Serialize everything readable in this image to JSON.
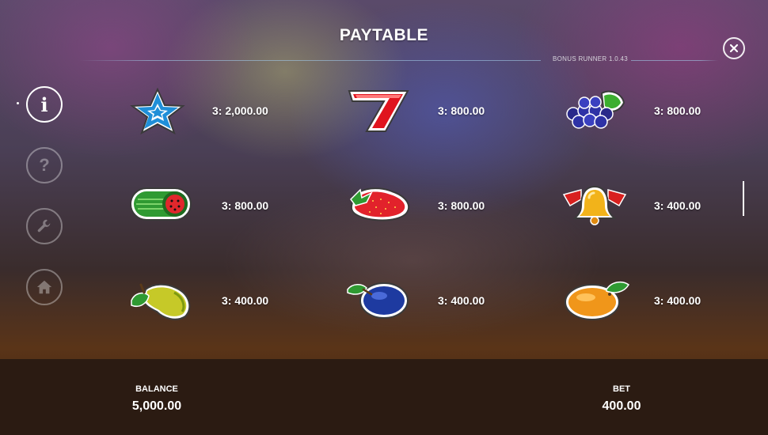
{
  "header": {
    "title": "PAYTABLE",
    "version": "BONUS RUNNER 1.0.43"
  },
  "close": {
    "icon": "close-icon",
    "label": "X"
  },
  "sidebar": {
    "items": [
      {
        "name": "info",
        "icon": "info-icon",
        "label": "i",
        "active": true
      },
      {
        "name": "help",
        "icon": "question-icon",
        "label": "?",
        "active": false
      },
      {
        "name": "settings",
        "icon": "wrench-icon",
        "active": false
      },
      {
        "name": "home",
        "icon": "home-icon",
        "active": false
      }
    ]
  },
  "symbols": [
    {
      "id": "star",
      "icon": "star-icon",
      "payout": "3: 2,000.00"
    },
    {
      "id": "seven",
      "icon": "seven-icon",
      "glyph": "7",
      "payout": "3: 800.00"
    },
    {
      "id": "grapes",
      "icon": "grapes-icon",
      "payout": "3: 800.00"
    },
    {
      "id": "watermelon",
      "icon": "watermelon-icon",
      "payout": "3: 800.00"
    },
    {
      "id": "strawberry",
      "icon": "strawberry-icon",
      "payout": "3: 800.00"
    },
    {
      "id": "bell",
      "icon": "bell-icon",
      "payout": "3: 400.00"
    },
    {
      "id": "pear",
      "icon": "pear-icon",
      "payout": "3: 400.00"
    },
    {
      "id": "plum",
      "icon": "plum-icon",
      "payout": "3: 400.00"
    },
    {
      "id": "orange",
      "icon": "orange-icon",
      "payout": "3: 400.00"
    }
  ],
  "footer": {
    "balance_label": "BALANCE",
    "balance_value": "5,000.00",
    "bet_label": "BET",
    "bet_value": "400.00"
  },
  "colors": {
    "footer_bg": "#2b1b12",
    "accent": "#ffffff"
  }
}
